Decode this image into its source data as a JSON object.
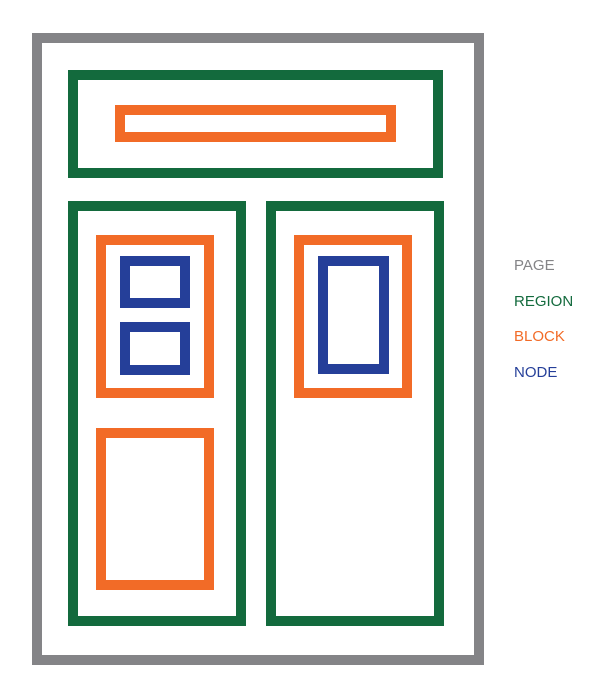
{
  "colors": {
    "page": "#848487",
    "region": "#136a3d",
    "block": "#f26b27",
    "node": "#253f99"
  },
  "legend": {
    "items": [
      {
        "label": "PAGE",
        "color": "#848487"
      },
      {
        "label": "REGION",
        "color": "#136a3d"
      },
      {
        "label": "BLOCK",
        "color": "#f26b27"
      },
      {
        "label": "NODE",
        "color": "#253f99"
      }
    ]
  }
}
